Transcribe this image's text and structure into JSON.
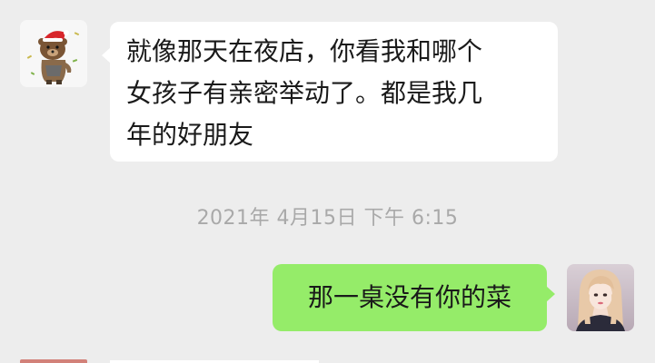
{
  "messages": [
    {
      "direction": "incoming",
      "sender_avatar": "bear-santa-hat-avatar",
      "text_lines": [
        "就像那天在夜店，你看我和哪个",
        "女孩子有亲密举动了。都是我几",
        "年的好朋友"
      ]
    },
    {
      "direction": "outgoing",
      "sender_avatar": "girl-portrait-avatar",
      "text_lines": [
        "那一桌没有你的菜"
      ]
    }
  ],
  "timestamp": "2021年 4月15日 下午 6:15",
  "colors": {
    "background": "#ededed",
    "incoming_bubble": "#ffffff",
    "outgoing_bubble": "#95ec69",
    "timestamp_text": "#a9a9a9"
  }
}
